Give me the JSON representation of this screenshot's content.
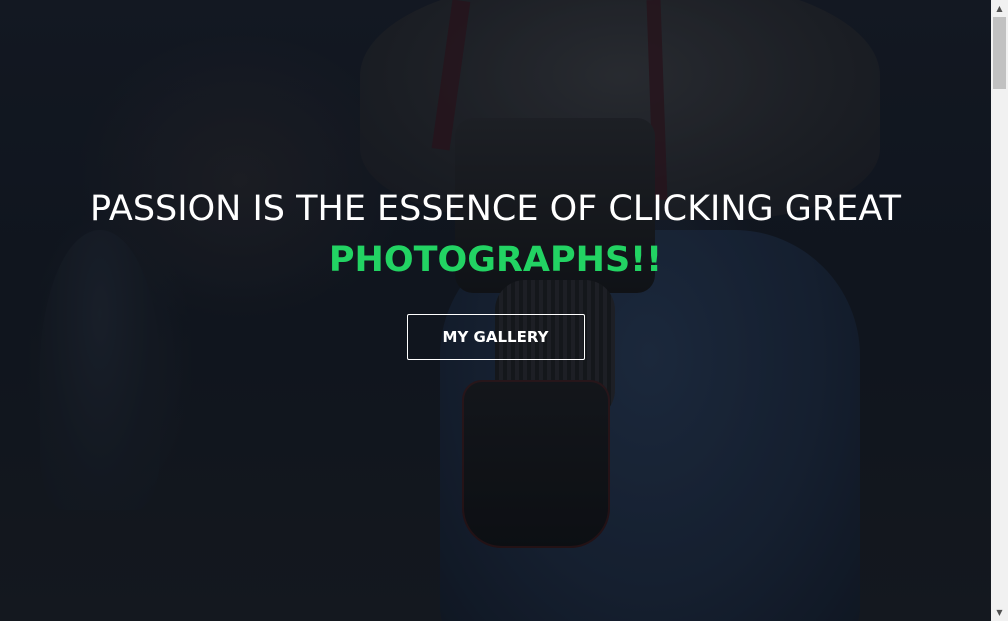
{
  "hero": {
    "headline": "PASSION IS THE ESSENCE OF CLICKING GREAT",
    "highlight": "PHOTOGRAPHS!!",
    "cta_label": "MY GALLERY",
    "background_image": "photographer-holding-camera"
  },
  "scrollbar": {
    "up_arrow": "▲",
    "down_arrow": "▼"
  },
  "colors": {
    "highlight": "#22d363",
    "text": "#ffffff"
  }
}
